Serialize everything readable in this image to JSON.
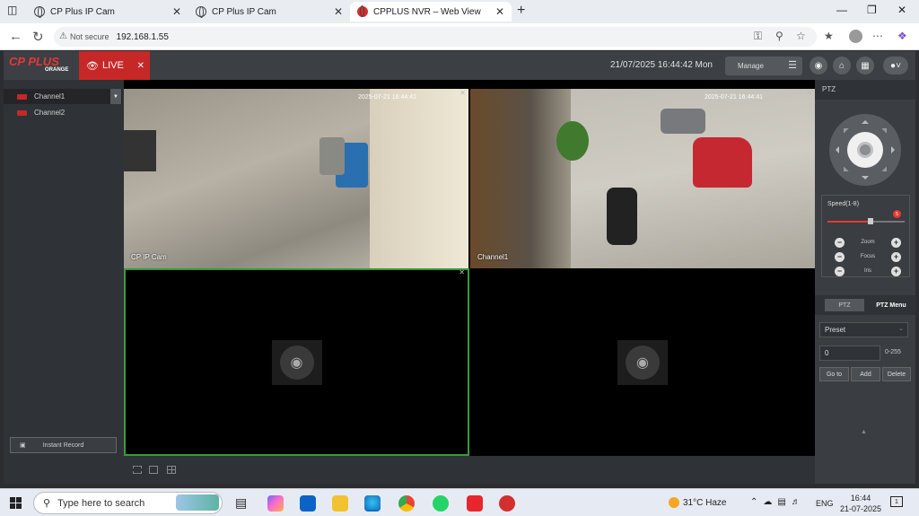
{
  "browser": {
    "tabs": [
      {
        "title": "CP Plus IP Cam",
        "active": false
      },
      {
        "title": "CP Plus IP Cam",
        "active": false
      },
      {
        "title": "CPPLUS NVR – Web View",
        "active": true
      }
    ],
    "security_label": "Not secure",
    "url": "192.168.1.55"
  },
  "app": {
    "brand": "CP PLUS",
    "brand_sub": "ORANGE",
    "live_label": "LIVE",
    "datetime": "21/07/2025 16:44:42 Mon",
    "manage_label": "Manage"
  },
  "channels": [
    {
      "name": "Channel1",
      "selected": true
    },
    {
      "name": "Channel2",
      "selected": false
    }
  ],
  "instant_record": "Instant Record",
  "video": {
    "cells": [
      {
        "label": "CP IP Cam",
        "timestamp": "2025-07-21 16:44:41",
        "has_feed": true
      },
      {
        "label": "Channel1",
        "timestamp": "2025-07-21 16:44:41",
        "has_feed": true
      },
      {
        "label": "",
        "has_feed": false
      },
      {
        "label": "",
        "has_feed": false
      }
    ]
  },
  "ptz": {
    "title": "PTZ",
    "speed_label": "Speed(1-8)",
    "speed_value": "5",
    "speed_fraction": 0.56,
    "controls": [
      "Zoom",
      "Focus",
      "Iris"
    ],
    "tabs": [
      "PTZ",
      "PTZ Menu"
    ],
    "active_tab": "PTZ Menu",
    "preset_select": "Preset",
    "preset_value": "0",
    "preset_range": "0-255",
    "buttons": [
      "Go to",
      "Add",
      "Delete"
    ]
  },
  "taskbar": {
    "search_placeholder": "Type here to search",
    "weather_temp": "31°C",
    "weather_text": "Haze",
    "lang": "ENG",
    "time": "16:44",
    "date": "21-07-2025",
    "notifications": "1"
  },
  "colors": {
    "accent": "#c62828",
    "panel": "#2f3236",
    "grid_border": "#3a9a3a"
  }
}
